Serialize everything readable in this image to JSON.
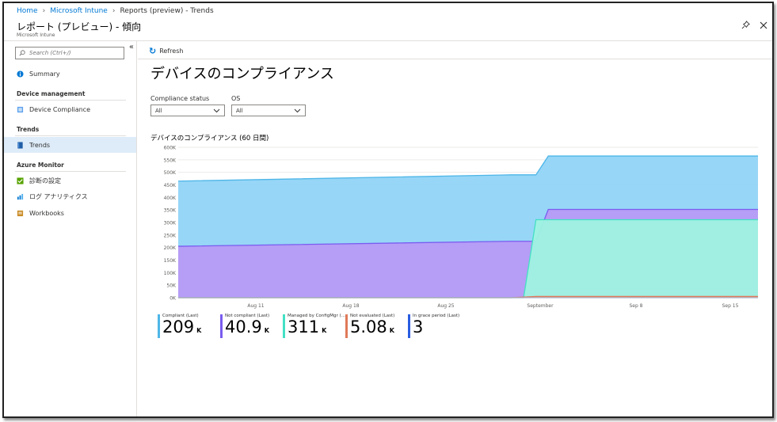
{
  "breadcrumb": {
    "home": "Home",
    "intune": "Microsoft Intune",
    "current": "Reports (preview) - Trends"
  },
  "blade": {
    "title": "レポート (プレビュー) - 傾向",
    "subtitle": "Microsoft Intune"
  },
  "icons": {
    "pin": "pin-icon",
    "close": "close-icon",
    "collapse": "double-chevron-left-icon",
    "refresh": "refresh-icon",
    "search": "search-icon"
  },
  "sidebar": {
    "search_placeholder": "Search (Ctrl+/)",
    "summary": "Summary",
    "device_management_head": "Device management",
    "device_compliance": "Device Compliance",
    "trends_head": "Trends",
    "trends": "Trends",
    "azure_monitor_head": "Azure Monitor",
    "diagnostics": "診断の設定",
    "log_analytics": "ログ アナリティクス",
    "workbooks": "Workbooks"
  },
  "toolbar": {
    "refresh": "Refresh"
  },
  "page": {
    "title": "デバイスのコンプライアンス"
  },
  "filters": {
    "compliance_label": "Compliance status",
    "compliance_value": "All",
    "os_label": "OS",
    "os_value": "All"
  },
  "chart_title": "デバイスのコンプライアンス (60 日間)",
  "colors": {
    "accent": "#0078d4",
    "compliant": "#91d4f7",
    "noncompliant": "#b79af5",
    "configmgr": "#9ff3e0",
    "notevaluated": "#ee9a7c",
    "grace": "#4c7ef5"
  },
  "chart_data": {
    "type": "area",
    "x_labels": [
      "Aug 11",
      "Aug 18",
      "Aug 25",
      "September",
      "Sep 8",
      "Sep 15"
    ],
    "y_ticks": [
      "600K",
      "550K",
      "500K",
      "450K",
      "400K",
      "350K",
      "300K",
      "250K",
      "200K",
      "150K",
      "100K",
      "50K",
      "0K"
    ],
    "ylim": [
      0,
      600000
    ],
    "series": [
      {
        "name": "Compliant (Last)",
        "color": "#91d4f7",
        "x": [
          "Aug 4",
          "Aug 31",
          "Sep 2",
          "Sep 3",
          "Sep 20"
        ],
        "values": [
          465000,
          490000,
          490000,
          565000,
          565000
        ]
      },
      {
        "name": "Not compliant (Last)",
        "color": "#b79af5",
        "x": [
          "Aug 4",
          "Aug 31",
          "Sep 2",
          "Sep 3",
          "Sep 20"
        ],
        "values": [
          205000,
          225000,
          225000,
          352000,
          352000
        ]
      },
      {
        "name": "Managed by ConfigMgr (...",
        "color": "#9ff3e0",
        "x": [
          "Aug 4",
          "Aug 31",
          "Sep 1",
          "Sep 2",
          "Sep 20"
        ],
        "values": [
          0,
          0,
          0,
          311000,
          311000
        ]
      },
      {
        "name": "Not evaluated (Last)",
        "color": "#ee9a7c",
        "x": [
          "Aug 4",
          "Aug 31",
          "Sep 2",
          "Sep 20"
        ],
        "values": [
          0,
          0,
          5080,
          5080
        ]
      },
      {
        "name": "In grace period (Last)",
        "color": "#4c7ef5",
        "x": [
          "Aug 4",
          "Sep 20"
        ],
        "values": [
          3,
          3
        ]
      }
    ]
  },
  "legend": [
    {
      "label": "Compliant (Last)",
      "value": "209",
      "unit": "K",
      "color": "#4eb6e8"
    },
    {
      "label": "Not compliant (Last)",
      "value": "40.9",
      "unit": "K",
      "color": "#7a5cf0"
    },
    {
      "label": "Managed by ConfigMgr (...",
      "value": "311",
      "unit": "K",
      "color": "#43e0c4"
    },
    {
      "label": "Not evaluated (Last)",
      "value": "5.08",
      "unit": "K",
      "color": "#e07a5a"
    },
    {
      "label": "In grace period (Last)",
      "value": "3",
      "unit": "",
      "color": "#2a5ee0"
    }
  ]
}
